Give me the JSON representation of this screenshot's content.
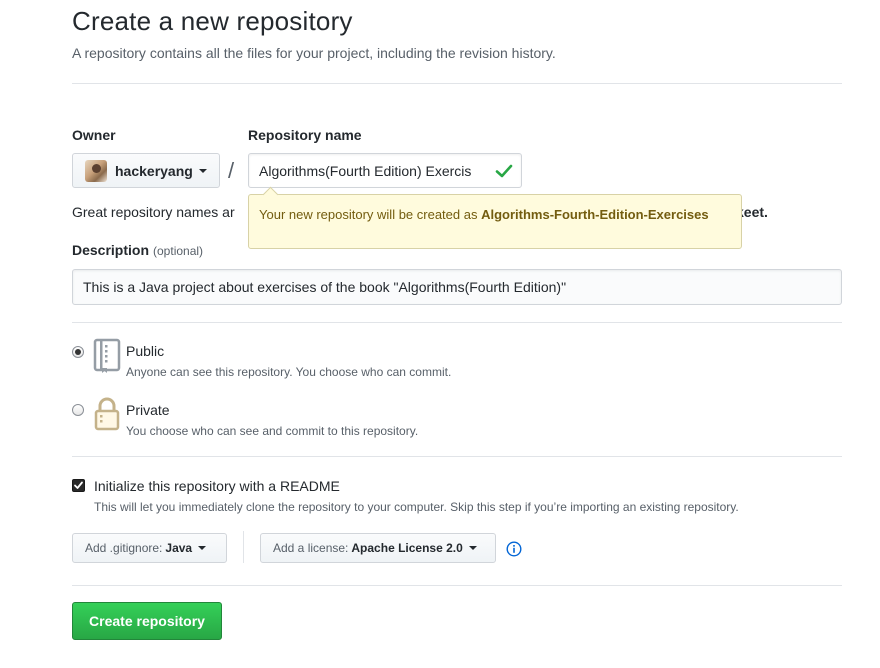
{
  "page": {
    "title": "Create a new repository",
    "subtitle": "A repository contains all the files for your project, including the revision history."
  },
  "owner": {
    "label": "Owner",
    "username": "hackeryang",
    "avatar_icon": "user-avatar"
  },
  "separator": "/",
  "repository": {
    "label": "Repository name",
    "value": "Algorithms(Fourth Edition) Exercis",
    "valid_icon": "check-icon",
    "valid_color": "#28a745"
  },
  "name_hint": {
    "lead": "Great repository names ar",
    "tail": "keet."
  },
  "tooltip": {
    "prefix": "Your new repository will be created as ",
    "name": "Algorithms-Fourth-Edition-Exercises"
  },
  "description": {
    "label": "Description",
    "optional": "(optional)",
    "value": "This is a Java project about exercises of the book \"Algorithms(Fourth Edition)\""
  },
  "visibility": {
    "public": {
      "title": "Public",
      "note": "Anyone can see this repository. You choose who can commit.",
      "selected": true,
      "icon": "book-icon"
    },
    "private": {
      "title": "Private",
      "note": "You choose who can see and commit to this repository.",
      "selected": false,
      "icon": "lock-icon"
    }
  },
  "readme": {
    "label": "Initialize this repository with a README",
    "note": "This will let you immediately clone the repository to your computer. Skip this step if you’re importing an existing repository.",
    "checked": true
  },
  "gitignore": {
    "prefix": "Add .gitignore:",
    "value": "Java"
  },
  "license": {
    "prefix": "Add a license:",
    "value": "Apache License 2.0"
  },
  "info_icon": "info-icon",
  "submit": {
    "label": "Create repository",
    "color": "#28a745"
  }
}
